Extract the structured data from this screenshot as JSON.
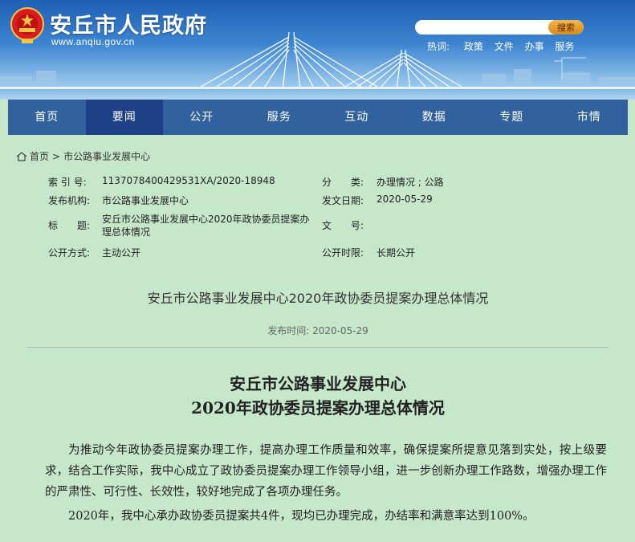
{
  "header": {
    "site_title": "安丘市人民政府",
    "site_url": "www.anqiu.gov.cn",
    "search": {
      "placeholder": "",
      "button_label": "搜索"
    },
    "hot": {
      "label": "热词:",
      "links": [
        "政策",
        "文件",
        "办事",
        "服务"
      ]
    }
  },
  "nav": {
    "items": [
      "首页",
      "要闻",
      "公开",
      "服务",
      "互动",
      "数据",
      "专题",
      "市情"
    ],
    "active_index": 1
  },
  "breadcrumb": {
    "home": "首页",
    "separator": ">",
    "current": "市公路事业发展中心"
  },
  "meta": {
    "index_no_label": "索 引 号:",
    "index_no": "1137078400429531XA/2020-18948",
    "category_label": "分　　类:",
    "category": "办理情况 ; 公路",
    "org_label": "发布机构:",
    "org": "市公路事业发展中心",
    "date_label": "发文日期:",
    "date": "2020-05-29",
    "title_label": "标　　题:",
    "title_line1": "安丘市公路事业发展中心2020年政协委员提案办",
    "title_line2": "理总体情况",
    "doc_no_label": "文　　号:",
    "doc_no": "",
    "method_label": "公开方式:",
    "method": "主动公开",
    "period_label": "公开时限:",
    "period": "长期公开"
  },
  "article": {
    "title": "安丘市公路事业发展中心2020年政协委员提案办理总体情况",
    "pub_time_label": "发布时间:",
    "pub_time": "2020-05-29",
    "doc_title_line1": "安丘市公路事业发展中心",
    "doc_title_line2": "2020年政协委员提案办理总体情况",
    "paragraphs": [
      "为推动今年政协委员提案办理工作，提高办理工作质量和效率，确保提案所提意见落到实处，按上级要求，结合工作实际，我中心成立了政协委员提案办理工作领导小组，进一步创新办理工作路数，增强办理工作的严肃性、可行性、长效性，较好地完成了各项办理任务。",
      "2020年，我中心承办政协委员提案共4件，现均已办理完成，办结率和满意率达到100%。"
    ]
  },
  "colors": {
    "nav_bg": "#31629e",
    "nav_active": "#1d3f86",
    "page_bg": "#c6e7c9",
    "search_button": "#e8a030"
  }
}
